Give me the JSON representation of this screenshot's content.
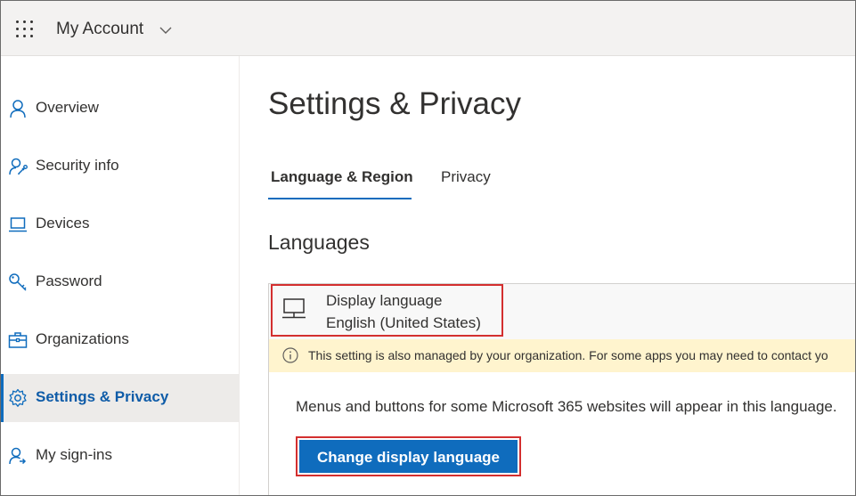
{
  "header": {
    "app_title": "My Account",
    "waffle_icon": "app-launcher-icon",
    "chevron_icon": "chevron-down-icon"
  },
  "sidebar": {
    "items": [
      {
        "label": "Overview",
        "icon": "person-icon",
        "active": false
      },
      {
        "label": "Security info",
        "icon": "person-key-icon",
        "active": false
      },
      {
        "label": "Devices",
        "icon": "laptop-icon",
        "active": false
      },
      {
        "label": "Password",
        "icon": "key-icon",
        "active": false
      },
      {
        "label": "Organizations",
        "icon": "briefcase-icon",
        "active": false
      },
      {
        "label": "Settings & Privacy",
        "icon": "gear-icon",
        "active": true
      },
      {
        "label": "My sign-ins",
        "icon": "person-sign-in-icon",
        "active": false
      }
    ]
  },
  "main": {
    "title": "Settings & Privacy",
    "tabs": [
      {
        "label": "Language & Region",
        "selected": true
      },
      {
        "label": "Privacy",
        "selected": false
      }
    ],
    "section_title": "Languages",
    "display_language": {
      "label": "Display language",
      "value": "English (United States)",
      "icon": "monitor-icon"
    },
    "notice": {
      "text": "This setting is also managed by your organization. For some apps you may need to contact yo",
      "icon": "info-icon"
    },
    "description": "Menus and buttons for some Microsoft 365 websites will appear in this language.",
    "change_button_label": "Change display language"
  },
  "colors": {
    "accent": "#0f6cbd",
    "highlight": "#d32f2f",
    "notice_bg": "#fff4ce",
    "topbar_bg": "#f3f2f1"
  }
}
